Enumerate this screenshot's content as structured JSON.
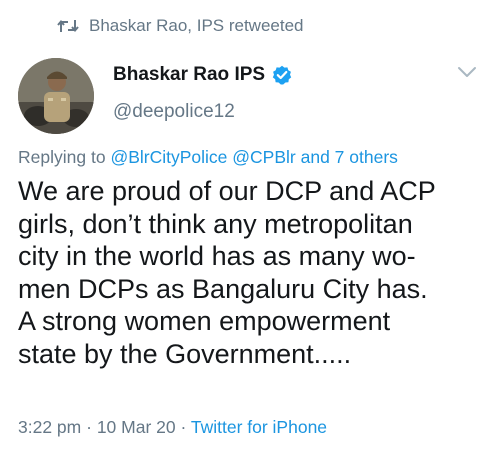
{
  "retweet_banner": {
    "icon": "retweet-icon",
    "text": "Bhaskar Rao, IPS retweeted"
  },
  "author": {
    "display_name": "Bhaskar Rao IPS",
    "verified_icon": "verified-badge-icon",
    "handle": "@deepolice12",
    "avatar_icon": "avatar"
  },
  "menu": {
    "icon": "chevron-down-icon"
  },
  "reply": {
    "prefix": "Replying to",
    "mentions": [
      "@BlrCityPolice",
      "@CPBlr"
    ],
    "others": "and 7 others"
  },
  "tweet": {
    "lines": [
      "We are proud of our DCP and ACP",
      "girls, don’t think any metropolitan",
      "city in the world has as many wo-",
      "men DCPs as Bangaluru City has.",
      "A strong women empowerment",
      "state by the Government....."
    ]
  },
  "meta": {
    "time": "3:22 pm",
    "date": "10 Mar 20",
    "separator": "·",
    "source": "Twitter for iPhone"
  },
  "colors": {
    "text_primary": "#14171a",
    "text_secondary": "#657786",
    "link": "#1b95e0",
    "verified": "#1da1f2",
    "chevron": "#aab8c2"
  }
}
